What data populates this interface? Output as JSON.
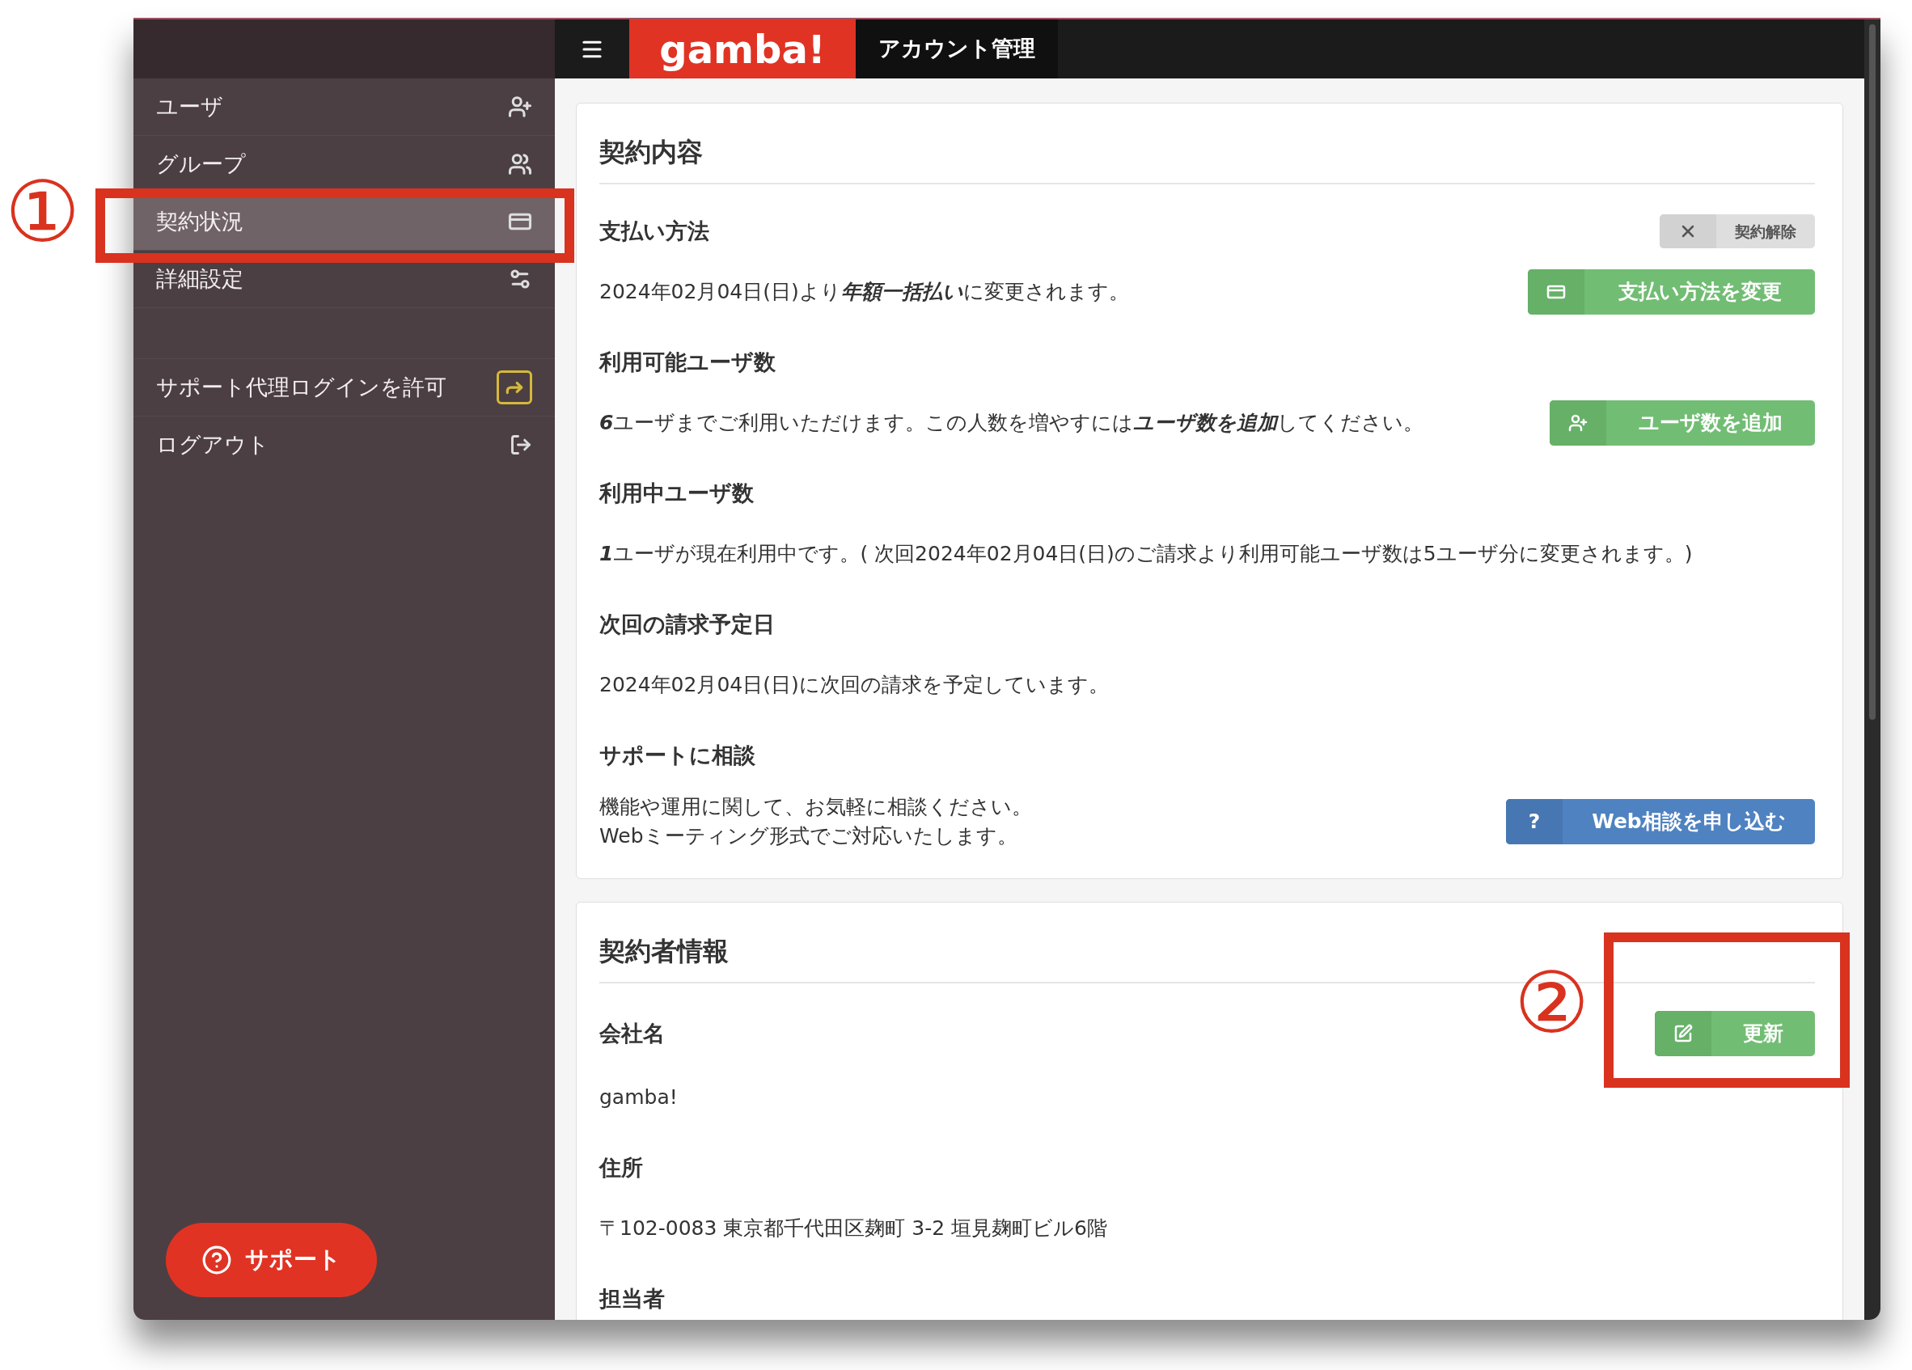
{
  "sidebar": {
    "items": [
      {
        "label": "ユーザ",
        "kind": "users",
        "selected": false
      },
      {
        "label": "グループ",
        "kind": "groups",
        "selected": false
      },
      {
        "label": "契約状況",
        "kind": "contract",
        "selected": true
      },
      {
        "label": "詳細設定",
        "kind": "settings",
        "selected": false
      }
    ],
    "actions": [
      {
        "label": "サポート代理ログインを許可",
        "kind": "proxy"
      },
      {
        "label": "ログアウト",
        "kind": "logout"
      }
    ],
    "support_button": {
      "label": "サポート"
    }
  },
  "header": {
    "logo": "gamba!",
    "title": "アカウント管理"
  },
  "cards": [
    {
      "title": "契約内容",
      "sections": [
        {
          "heading": "支払い方法",
          "heading_button": {
            "label": "契約解除",
            "kind": "cancel"
          },
          "lines": [
            "2024年02月04日(日)より**年額一括払い**に変更されます。"
          ],
          "button": {
            "label": "支払い方法を変更",
            "kind": "payment"
          }
        },
        {
          "heading": "利用可能ユーザ数",
          "lines": [
            "**6**ユーザまでご利用いただけます。この人数を増やすには**ユーザ数を追加**してください。"
          ],
          "button": {
            "label": "ユーザ数を追加",
            "kind": "adduser"
          }
        },
        {
          "heading": "利用中ユーザ数",
          "lines": [
            "**1**ユーザが現在利用中です。( 次回2024年02月04日(日)のご請求より利用可能ユーザ数は5ユーザ分に変更されます。)"
          ]
        },
        {
          "heading": "次回の請求予定日",
          "lines": [
            "2024年02月04日(日)に次回の請求を予定しています。"
          ]
        },
        {
          "heading": "サポートに相談",
          "lines": [
            "機能や運用に関して、お気軽に相談ください。",
            "Webミーティング形式でご対応いたします。"
          ],
          "button": {
            "label": "Web相談を申し込む",
            "kind": "consult",
            "symbol": "?"
          }
        }
      ]
    },
    {
      "title": "契約者情報",
      "sections": [
        {
          "heading": "会社名",
          "heading_button": {
            "label": "更新",
            "kind": "update"
          },
          "lines": [
            "gamba!"
          ]
        },
        {
          "heading": "住所",
          "lines": [
            "〒102-0083 東京都千代田区麹町 3-2 垣見麹町ビル6階"
          ]
        },
        {
          "heading": "担当者"
        }
      ]
    }
  ],
  "annotations": [
    {
      "label": "①"
    },
    {
      "label": "②"
    }
  ]
}
